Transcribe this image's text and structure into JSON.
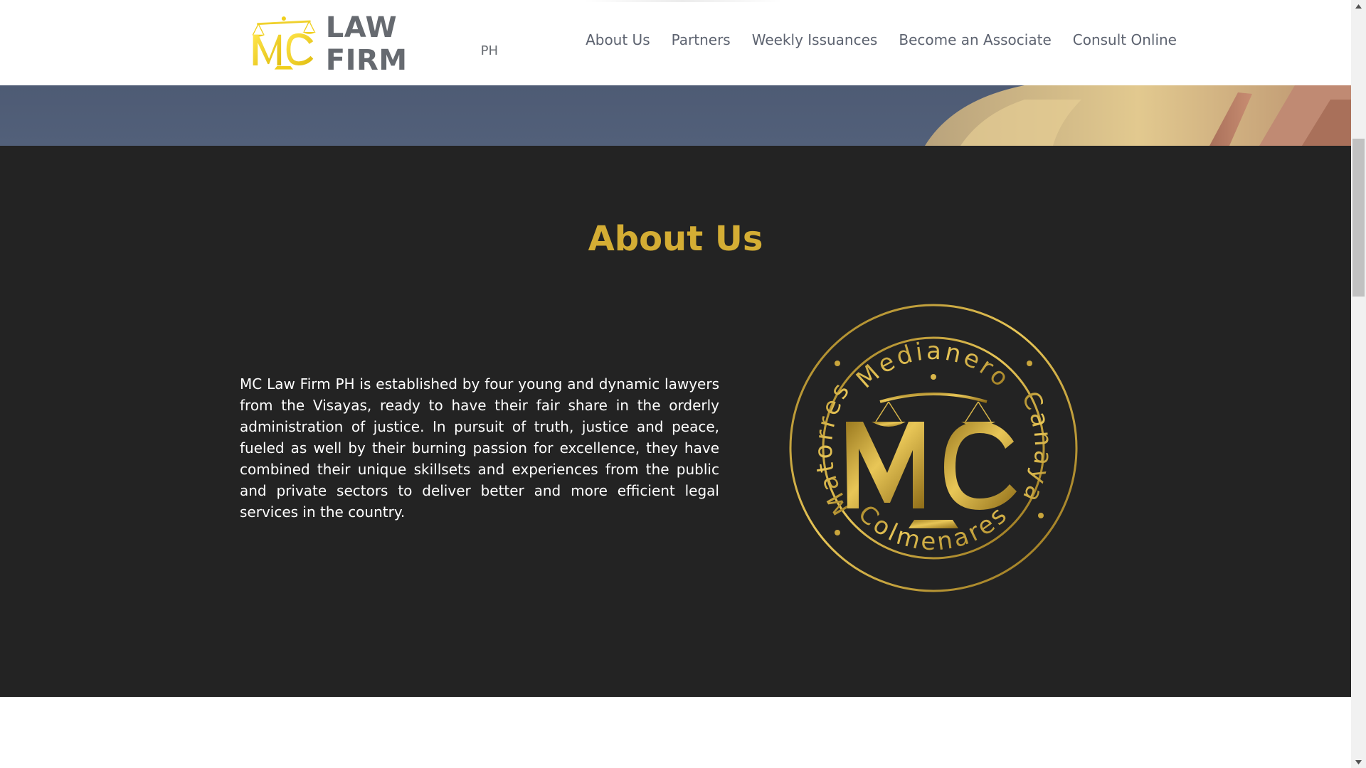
{
  "header": {
    "logo_initials": "MC",
    "logo_name": "LAW FIRM",
    "logo_suffix": "PH",
    "nav": [
      {
        "label": "About Us"
      },
      {
        "label": "Partners"
      },
      {
        "label": "Weekly Issuances"
      },
      {
        "label": "Become an Associate"
      },
      {
        "label": "Consult Online"
      }
    ]
  },
  "about": {
    "title": "About Us",
    "body": "MC Law Firm PH is established by four young and dynamic lawyers from the Visayas, ready to have their fair share in the orderly administration of justice. In pursuit of truth, justice and peace, fueled as well by their burning passion for excellence, they have combined their unique skillsets and experiences from the public and private sectors to deliver better and more efficient legal services in the country.",
    "seal": {
      "top": "Medianero",
      "right": "Canaya",
      "bottom": "Colmenares",
      "left": "Matorres",
      "initials": "MC"
    }
  },
  "colors": {
    "gold": "#d4ad34",
    "dark_bg": "#232323",
    "nav_text": "#5d6370",
    "hero_blue": "#4e5b74"
  },
  "icons": {
    "scroll_up": "triangle-up-icon",
    "scroll_down": "triangle-down-icon",
    "logo": "scales-of-justice-icon"
  }
}
